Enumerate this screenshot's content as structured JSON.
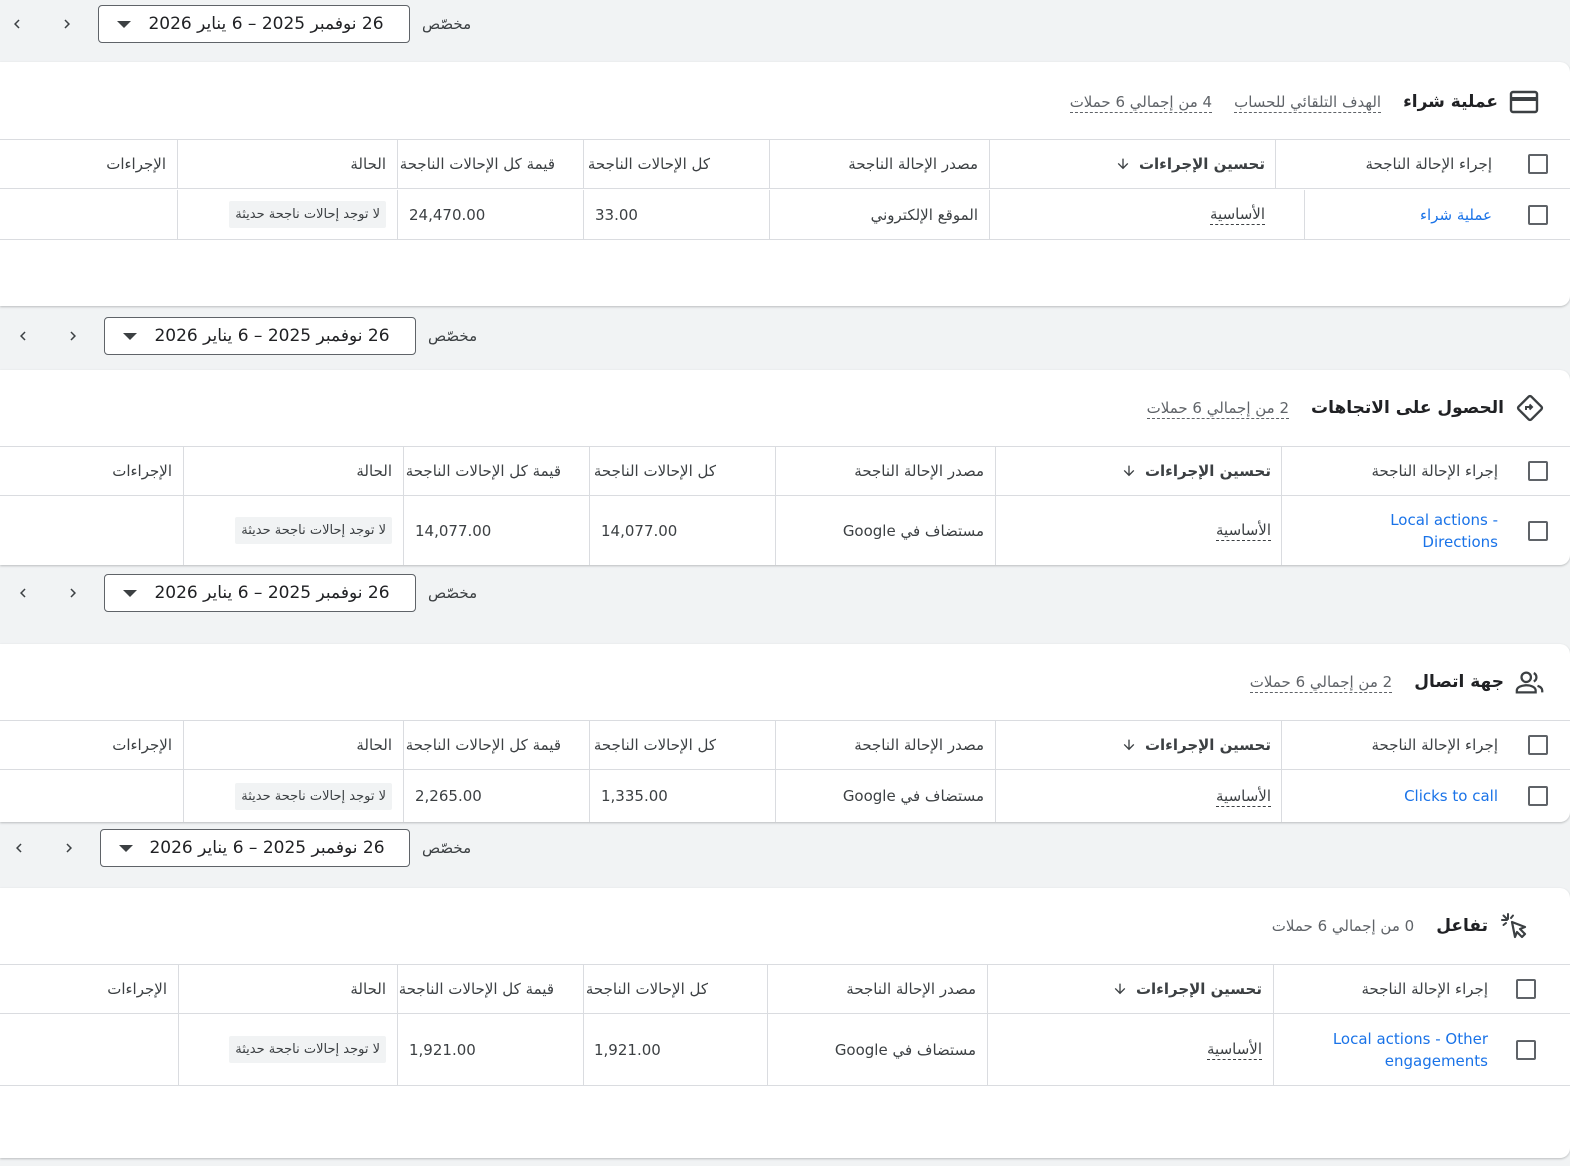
{
  "date_range": {
    "custom_label": "مخصّص",
    "range": "26 نوفمبر 2025 – 6 يناير 2026"
  },
  "table_headers": {
    "conversion_action": "إجراء الإحالة الناجحة",
    "action_optimization": "تحسين الإجراءات",
    "source": "مصدر الإحالة الناجحة",
    "all_conversions": "كل الإحالات الناجحة",
    "all_conv_value": "قيمة كل الإحالات الناجحة",
    "status": "الحالة",
    "actions": "الإجراءات"
  },
  "cards": [
    {
      "title": "عملية شراء",
      "icon": "credit-card-icon",
      "auto_goal": "الهدف التلقائي للحساب",
      "campaigns": "4 من إجمالي 6 حملات",
      "row": {
        "action": "عملية شراء",
        "optimization": "الأساسية",
        "source": "الموقع الإلكتروني",
        "all_conv": "33.00",
        "all_value": "24,470.00",
        "status": "لا توجد إحالات ناجحة حديثة"
      }
    },
    {
      "title": "الحصول على الاتجاهات",
      "icon": "directions-icon",
      "campaigns": "2 من إجمالي 6 حملات",
      "row": {
        "action_line1": "Local actions -",
        "action_line2": "Directions",
        "optimization": "الأساسية",
        "source": "مستضاف في Google",
        "all_conv": "14,077.00",
        "all_value": "14,077.00",
        "status": "لا توجد إحالات ناجحة حديثة"
      }
    },
    {
      "title": "جهة اتصال",
      "icon": "people-icon",
      "campaigns": "2 من إجمالي 6 حملات",
      "row": {
        "action": "Clicks to call",
        "optimization": "الأساسية",
        "source": "مستضاف في Google",
        "all_conv": "1,335.00",
        "all_value": "2,265.00",
        "status": "لا توجد إحالات ناجحة حديثة"
      }
    },
    {
      "title": "تفاعل",
      "icon": "click-sparkle-icon",
      "campaigns": "0 من إجمالي 6 حملات",
      "row": {
        "action_line1": "Local actions - Other",
        "action_line2": "engagements",
        "optimization": "الأساسية",
        "source": "مستضاف في Google",
        "all_conv": "1,921.00",
        "all_value": "1,921.00",
        "status": "لا توجد إحالات ناجحة حديثة"
      }
    }
  ]
}
